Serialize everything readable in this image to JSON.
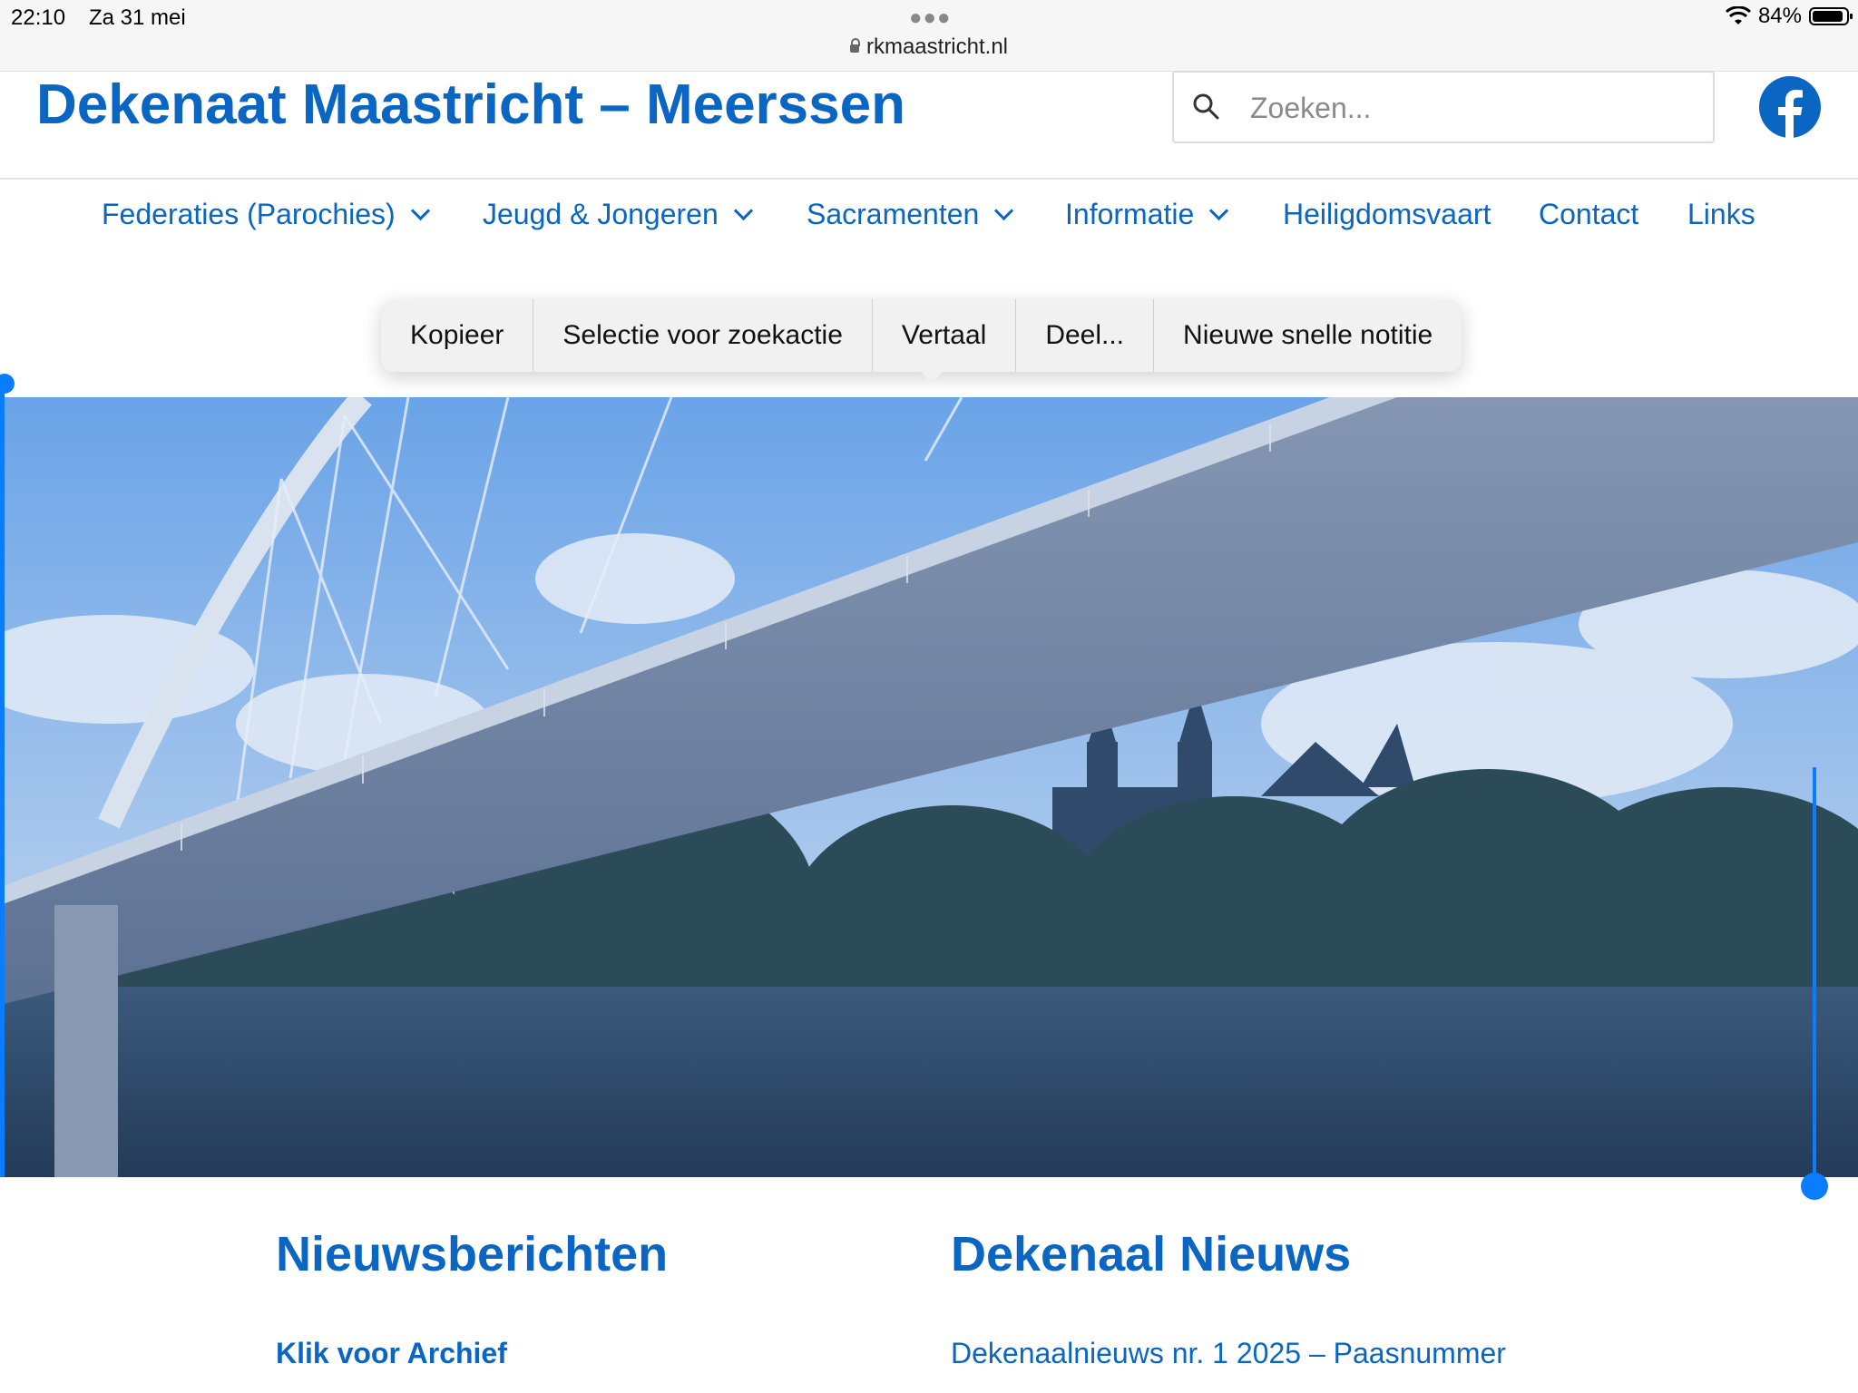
{
  "status_bar": {
    "time": "22:10",
    "date": "Za 31 mei",
    "battery": "84%",
    "url": "rkmaastricht.nl"
  },
  "header": {
    "site_title": "Dekenaat Maastricht – Meerssen",
    "search_placeholder": "Zoeken..."
  },
  "nav": {
    "items": [
      {
        "label": "Federaties (Parochies)",
        "has_dropdown": true
      },
      {
        "label": "Jeugd & Jongeren",
        "has_dropdown": true
      },
      {
        "label": "Sacramenten",
        "has_dropdown": true
      },
      {
        "label": "Informatie",
        "has_dropdown": true
      },
      {
        "label": "Heiligdomsvaart",
        "has_dropdown": false
      },
      {
        "label": "Contact",
        "has_dropdown": false
      },
      {
        "label": "Links",
        "has_dropdown": false
      }
    ]
  },
  "context_menu": {
    "items": [
      "Kopieer",
      "Selectie voor zoekactie",
      "Vertaal",
      "Deel...",
      "Nieuwe snelle notitie"
    ]
  },
  "sections": {
    "left": {
      "heading": "Nieuwsberichten",
      "link": "Klik voor Archief"
    },
    "right": {
      "heading": "Dekenaal Nieuws",
      "link": "Dekenaalnieuws nr. 1 2025 – Paasnummer"
    }
  },
  "colors": {
    "brand": "#0a66c2",
    "selection": "#0a7cff"
  },
  "icons": {
    "search": "magnifier",
    "social": "facebook-logo",
    "address": "lock"
  }
}
